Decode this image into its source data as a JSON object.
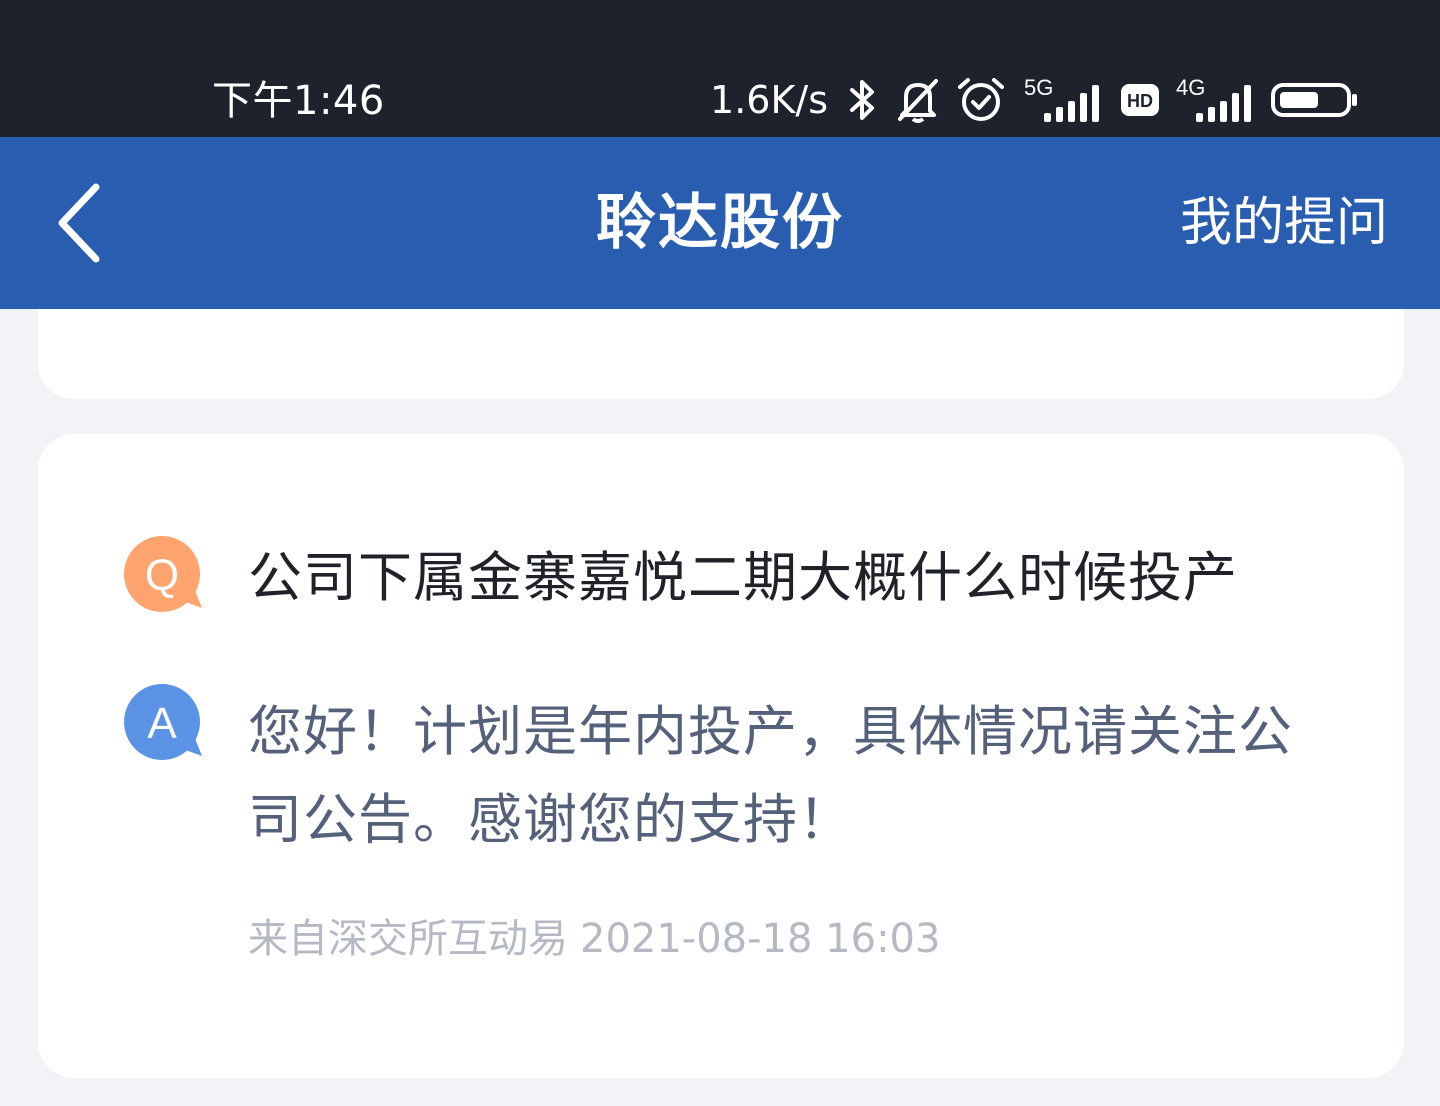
{
  "status_bar": {
    "time": "下午1:46",
    "net_speed": "1.6K/s",
    "icons": [
      "bluetooth-icon",
      "bell-off-icon",
      "alarm-icon",
      "signal-5g-icon",
      "hd-icon",
      "signal-4g-icon",
      "battery-icon"
    ],
    "network_5g_label": "5G",
    "hd_label": "HD",
    "network_4g_label": "4G"
  },
  "app_bar": {
    "title": "聆达股份",
    "right_action": "我的提问",
    "back_icon": "chevron-left-icon",
    "background_color": "#285db0"
  },
  "qa": {
    "question_badge": "Q",
    "question": "公司下属金寨嘉悦二期大概什么时候投产",
    "answer_badge": "A",
    "answer": "您好！计划是年内投产，具体情况请关注公司公告。感谢您的支持！",
    "source": "来自深交所互动易",
    "timestamp": "2021-08-18 16:03",
    "question_badge_color": "#ffa46e",
    "answer_badge_color": "#5b94e6"
  }
}
